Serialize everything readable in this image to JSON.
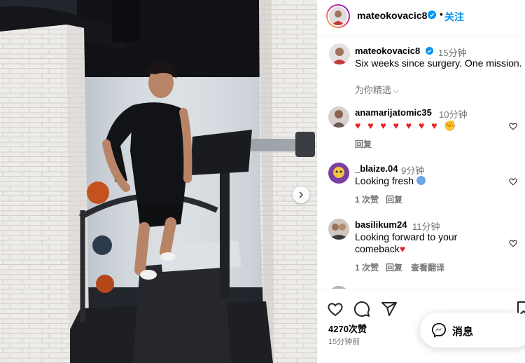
{
  "post": {
    "username": "mateokovacic8",
    "follow_label": "关注",
    "separator": "•",
    "caption": {
      "username": "mateokovacic8",
      "time": "15分钟",
      "text": "Six weeks since surgery. One mission."
    },
    "see_translation": "为你精选",
    "likes": "4270次赞",
    "posted_time": "15分钟前",
    "message_label": "消息"
  },
  "comments": [
    {
      "username": "anamarijatomic35",
      "time": "10分钟",
      "text": "♥ ♥ ♥ ♥ ♥ ♥ ♥",
      "actions": {
        "reply": "回复"
      }
    },
    {
      "username": "_blaize.04",
      "time": "9分钟",
      "text": "Looking fresh",
      "actions": {
        "likes": "1 次赞",
        "reply": "回复"
      }
    },
    {
      "username": "basilikum24",
      "time": "11分钟",
      "text_line1": "Looking forward to your",
      "text_line2": "comeback",
      "actions": {
        "likes": "1 次赞",
        "reply": "回复",
        "translate": "查看翻译"
      }
    }
  ],
  "icons": {
    "like": "heart-icon",
    "comment": "comment-icon",
    "share": "share-icon",
    "save": "bookmark-icon",
    "messenger": "messenger-icon",
    "verified": "verified-badge-icon",
    "carousel_next": "chevron-right-icon"
  },
  "colors": {
    "accent": "#0095f6",
    "secondary_text": "#737373",
    "heart_red": "#ed1c24"
  }
}
